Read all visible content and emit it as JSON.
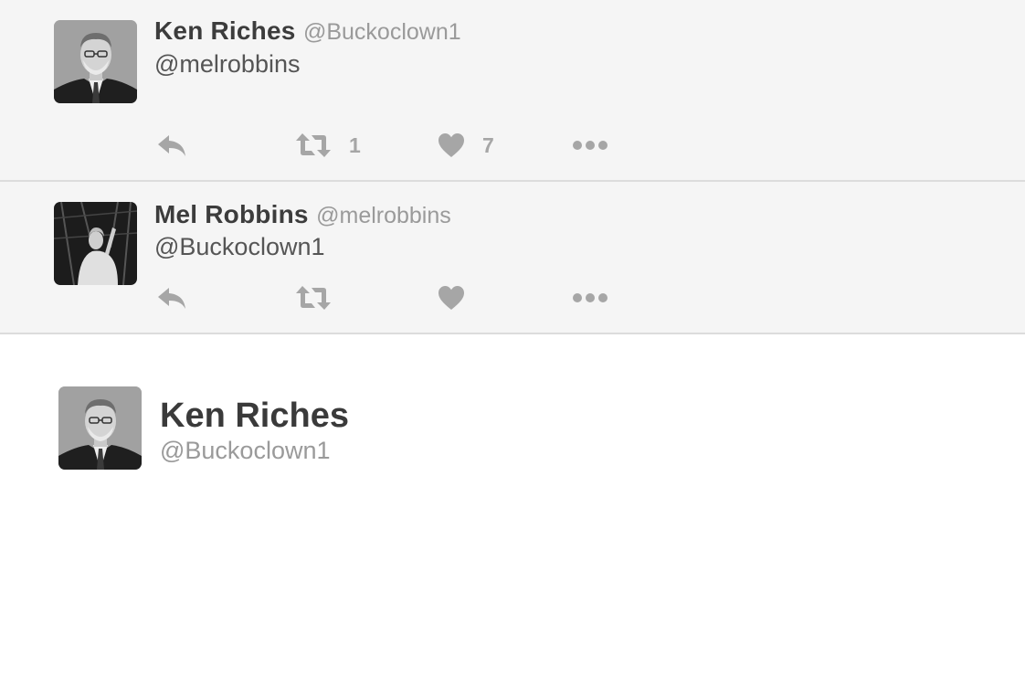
{
  "tweets": [
    {
      "author_name": "Ken Riches",
      "author_handle": "@Buckoclown1",
      "text": "@melrobbins",
      "avatar": "ken-riches-avatar",
      "retweet_count": "1",
      "like_count": "7"
    },
    {
      "author_name": "Mel Robbins",
      "author_handle": "@melrobbins",
      "text": "@Buckoclown1",
      "avatar": "mel-robbins-avatar",
      "retweet_count": "",
      "like_count": ""
    }
  ],
  "profile": {
    "name": "Ken Riches",
    "handle": "@Buckoclown1",
    "avatar": "ken-riches-avatar"
  },
  "icons": {
    "reply": "reply-icon",
    "retweet": "retweet-icon",
    "like": "heart-icon",
    "more": "more-dots-icon"
  },
  "colors": {
    "tweet_background": "#f5f5f5",
    "action_icon": "#a6a6a6",
    "name_text": "#3c3c3c",
    "handle_text": "#9a9a9a"
  }
}
